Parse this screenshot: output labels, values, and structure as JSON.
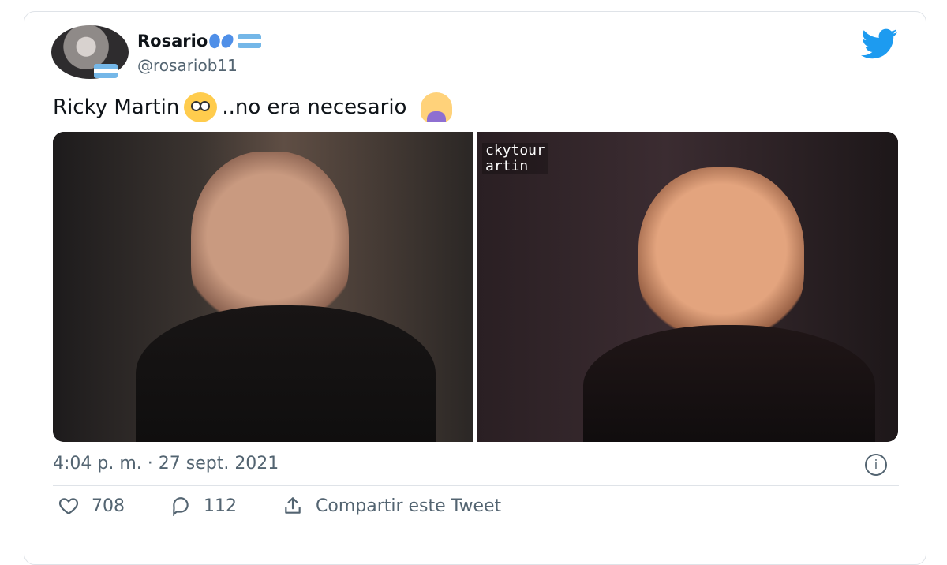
{
  "tweet": {
    "display_name": "Rosario",
    "handle": "@rosariob11",
    "text": "Ricky Martin",
    "text_suffix": "..no era necesario",
    "image_overlay_line1": "ckytour",
    "image_overlay_line2": "artin",
    "timestamp": "4:04 p. m. · 27 sept. 2021",
    "info_symbol": "i"
  },
  "actions": {
    "likes": "708",
    "replies": "112",
    "share_label": "Compartir este Tweet"
  },
  "colors": {
    "twitter_blue": "#1d9bf0",
    "muted_text": "#536471",
    "border": "#dfe3e8"
  },
  "icons": [
    "butterfly-emoji",
    "argentina-flag",
    "twitter-bird-icon",
    "flushed-face-emoji",
    "facepalm-emoji",
    "heart-icon",
    "reply-icon",
    "share-icon",
    "info-icon"
  ]
}
